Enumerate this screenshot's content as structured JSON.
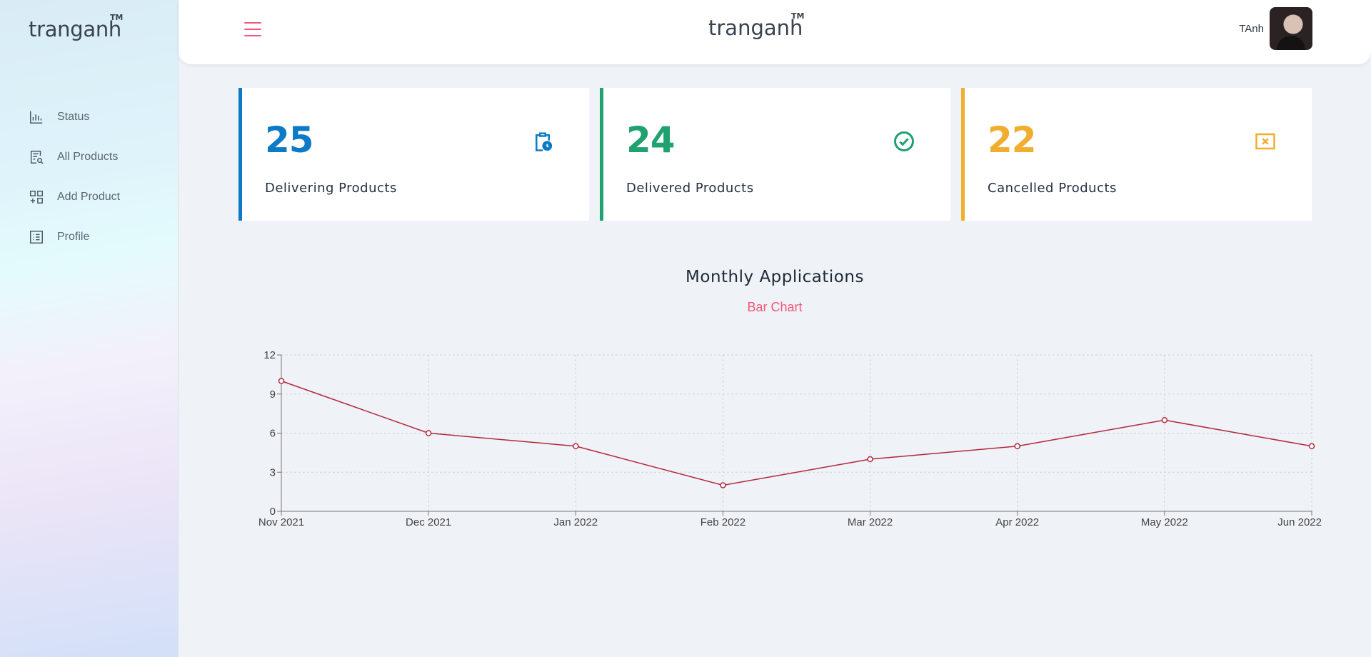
{
  "brand": {
    "name": "tranganh",
    "tm": "TM"
  },
  "sidebar": {
    "items": [
      {
        "label": "Status",
        "icon": "bar-chart-icon"
      },
      {
        "label": "All Products",
        "icon": "document-search-icon"
      },
      {
        "label": "Add Product",
        "icon": "grid-add-icon"
      },
      {
        "label": "Profile",
        "icon": "list-icon"
      }
    ]
  },
  "header": {
    "user_name": "TAnh"
  },
  "cards": [
    {
      "value": "25",
      "label": "Delivering Products",
      "color": "#0d7ac6",
      "icon": "clipboard-clock-icon"
    },
    {
      "value": "24",
      "label": "Delivered Products",
      "color": "#1fa170",
      "icon": "check-circle-icon"
    },
    {
      "value": "22",
      "label": "Cancelled Products",
      "color": "#f0ad2e",
      "icon": "close-box-icon"
    }
  ],
  "chart": {
    "title": "Monthly Applications",
    "subtitle": "Bar Chart",
    "line_color": "#b3283c"
  },
  "chart_data": {
    "type": "line",
    "categories": [
      "Nov 2021",
      "Dec 2021",
      "Jan 2022",
      "Feb 2022",
      "Mar 2022",
      "Apr 2022",
      "May 2022",
      "Jun 2022"
    ],
    "values": [
      10,
      6,
      5,
      2,
      4,
      5,
      7,
      5
    ],
    "ylim": [
      0,
      12
    ],
    "yticks": [
      0,
      3,
      6,
      9,
      12
    ],
    "grid": true
  }
}
